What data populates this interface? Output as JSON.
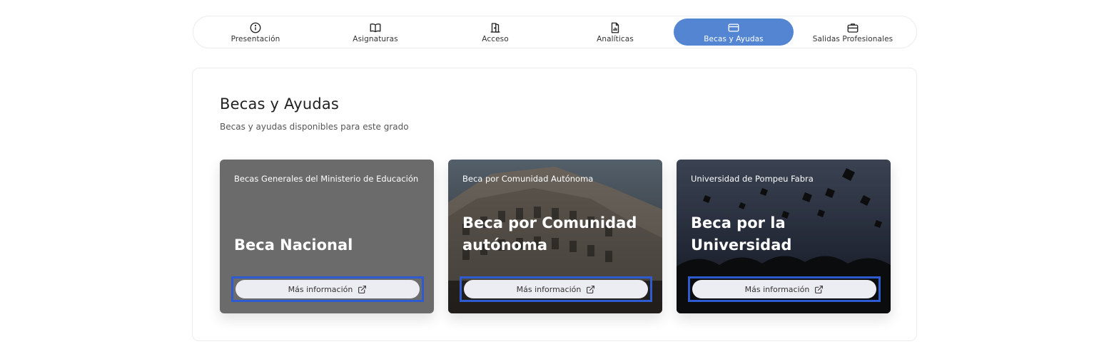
{
  "tabs": [
    {
      "label": "Presentación",
      "icon": "info-icon"
    },
    {
      "label": "Asignaturas",
      "icon": "book-icon"
    },
    {
      "label": "Acceso",
      "icon": "door-icon"
    },
    {
      "label": "Analíticas",
      "icon": "report-icon"
    },
    {
      "label": "Becas y Ayudas",
      "icon": "credit-card-icon",
      "active": true
    },
    {
      "label": "Salidas Profesionales",
      "icon": "briefcase-icon"
    }
  ],
  "section": {
    "title": "Becas y Ayudas",
    "subtitle": "Becas y ayudas disponibles para este grado"
  },
  "cards": [
    {
      "provider": "Becas Generales del Ministerio de Educación",
      "title": "Beca Nacional",
      "button": "Más información",
      "background": "gray"
    },
    {
      "provider": "Beca por Comunidad Autónoma",
      "title": "Beca por Comunidad autónoma",
      "button": "Más información",
      "background": "building-photo"
    },
    {
      "provider": "Universidad de Pompeu Fabra",
      "title": "Beca por la Universidad",
      "button": "Más información",
      "background": "graduation-photo"
    }
  ],
  "colors": {
    "accent": "#5385d3",
    "highlight_frame": "#2f5bd1",
    "card_gray": "#6b6b6b"
  }
}
